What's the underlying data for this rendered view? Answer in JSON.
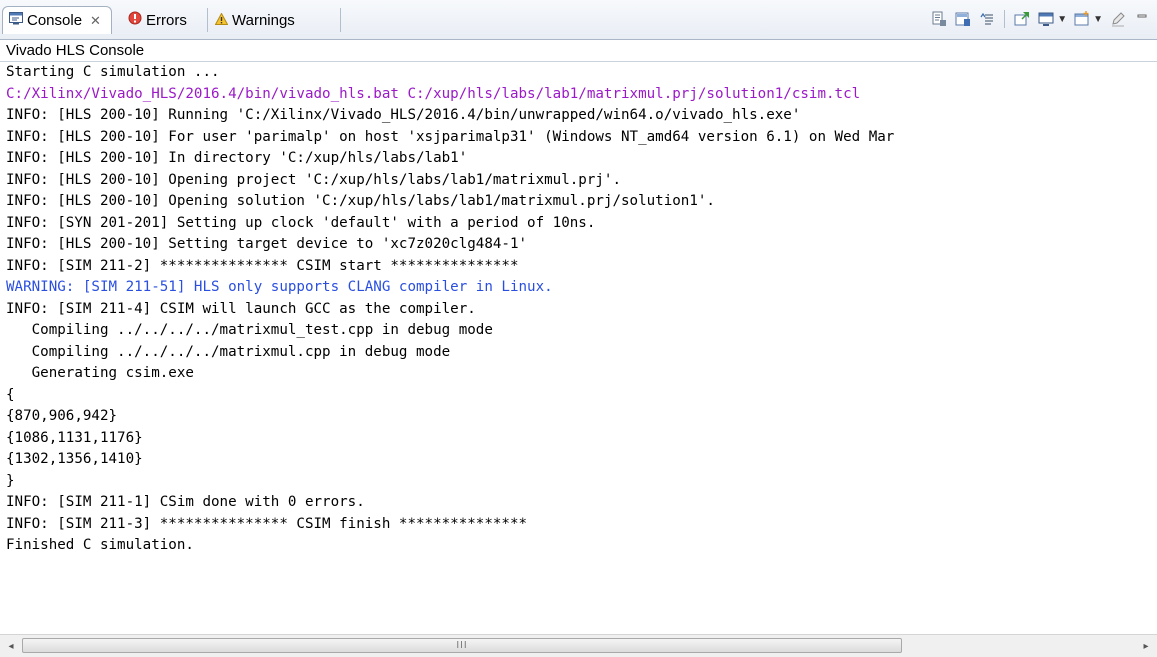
{
  "tabs": {
    "console": {
      "label": "Console",
      "icon": "console-icon",
      "close": "✕"
    },
    "errors": {
      "label": "Errors",
      "icon": "error-icon"
    },
    "warnings": {
      "label": "Warnings",
      "icon": "warning-icon"
    }
  },
  "toolbar": {
    "icons": [
      "clear-console-icon",
      "scroll-lock-icon",
      "word-wrap-icon",
      "pin-console-icon",
      "display-console-icon",
      "open-console-icon",
      "edit-icon",
      "minimize-icon"
    ]
  },
  "console_title": "Vivado HLS Console",
  "lines": {
    "l0": "Starting C simulation ...",
    "l1": "C:/Xilinx/Vivado_HLS/2016.4/bin/vivado_hls.bat C:/xup/hls/labs/lab1/matrixmul.prj/solution1/csim.tcl",
    "l2": "INFO: [HLS 200-10] Running 'C:/Xilinx/Vivado_HLS/2016.4/bin/unwrapped/win64.o/vivado_hls.exe'",
    "l3": "INFO: [HLS 200-10] For user 'parimalp' on host 'xsjparimalp31' (Windows NT_amd64 version 6.1) on Wed Mar",
    "l4": "INFO: [HLS 200-10] In directory 'C:/xup/hls/labs/lab1'",
    "l5": "INFO: [HLS 200-10] Opening project 'C:/xup/hls/labs/lab1/matrixmul.prj'.",
    "l6": "INFO: [HLS 200-10] Opening solution 'C:/xup/hls/labs/lab1/matrixmul.prj/solution1'.",
    "l7": "INFO: [SYN 201-201] Setting up clock 'default' with a period of 10ns.",
    "l8": "INFO: [HLS 200-10] Setting target device to 'xc7z020clg484-1'",
    "l9": "INFO: [SIM 211-2] *************** CSIM start ***************",
    "l10": "WARNING: [SIM 211-51] HLS only supports CLANG compiler in Linux.",
    "l11": "INFO: [SIM 211-4] CSIM will launch GCC as the compiler.",
    "l12": "   Compiling ../../../../matrixmul_test.cpp in debug mode",
    "l13": "   Compiling ../../../../matrixmul.cpp in debug mode",
    "l14": "   Generating csim.exe",
    "l15": "{",
    "l16": "{870,906,942}",
    "l17": "{1086,1131,1176}",
    "l18": "{1302,1356,1410}",
    "l19": "}",
    "l20": "INFO: [SIM 211-1] CSim done with 0 errors.",
    "l21": "INFO: [SIM 211-3] *************** CSIM finish ***************",
    "l22": "Finished C simulation."
  },
  "colors": {
    "command": "#9b19c8",
    "warning": "#2a4fe0",
    "text": "#000000"
  },
  "scrollbar": {
    "thumb_glyph": "III",
    "left_arrow": "◂",
    "right_arrow": "▸"
  }
}
